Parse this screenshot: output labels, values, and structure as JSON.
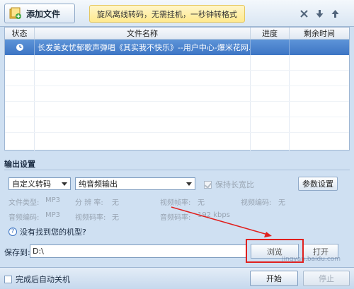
{
  "toolbar": {
    "add_file_label": "添加文件",
    "banner_text": "旋风离线转码，无需挂机，一秒钟转格式",
    "icons": [
      "close-icon",
      "arrow-down-icon",
      "arrow-up-icon"
    ]
  },
  "table": {
    "headers": {
      "status": "状态",
      "name": "文件名称",
      "progress": "进度",
      "remaining": "剩余时间"
    },
    "rows": [
      {
        "status_icon": "clock-icon",
        "name": "长发美女忧郁歌声弹唱《其实我不快乐》--用户中心-爆米花网...",
        "progress": "",
        "remaining": ""
      }
    ]
  },
  "settings": {
    "title": "输出设置",
    "preset_select": "自定义转码",
    "output_select": "纯音频输出",
    "keep_ratio_label": "保持长宽比",
    "param_button": "参数设置",
    "info": {
      "file_type_label": "文件类型:",
      "file_type_value": "MP3",
      "resolution_label": "分 辨 率:",
      "resolution_value": "无",
      "video_fps_label": "视频帧率:",
      "video_fps_value": "无",
      "video_codec_label": "视频编码:",
      "video_codec_value": "无",
      "audio_codec_label": "音频编码:",
      "audio_codec_value": "MP3",
      "video_bitrate_label": "视频码率:",
      "video_bitrate_value": "无",
      "audio_bitrate_label": "音频码率:",
      "audio_bitrate_value": "192 kbps"
    },
    "help_text": "没有找到您的机型?"
  },
  "save": {
    "label": "保存到:",
    "path": "D:\\",
    "browse_button": "浏览",
    "open_button": "打开"
  },
  "bottom": {
    "shutdown_label": "完成后自动关机",
    "start_button": "开始",
    "stop_button": "停止"
  },
  "watermark": "jingyan.baidu.com",
  "colors": {
    "selected_row": "#3d75c4",
    "banner": "#ffe98e",
    "highlight": "#e0201e"
  }
}
